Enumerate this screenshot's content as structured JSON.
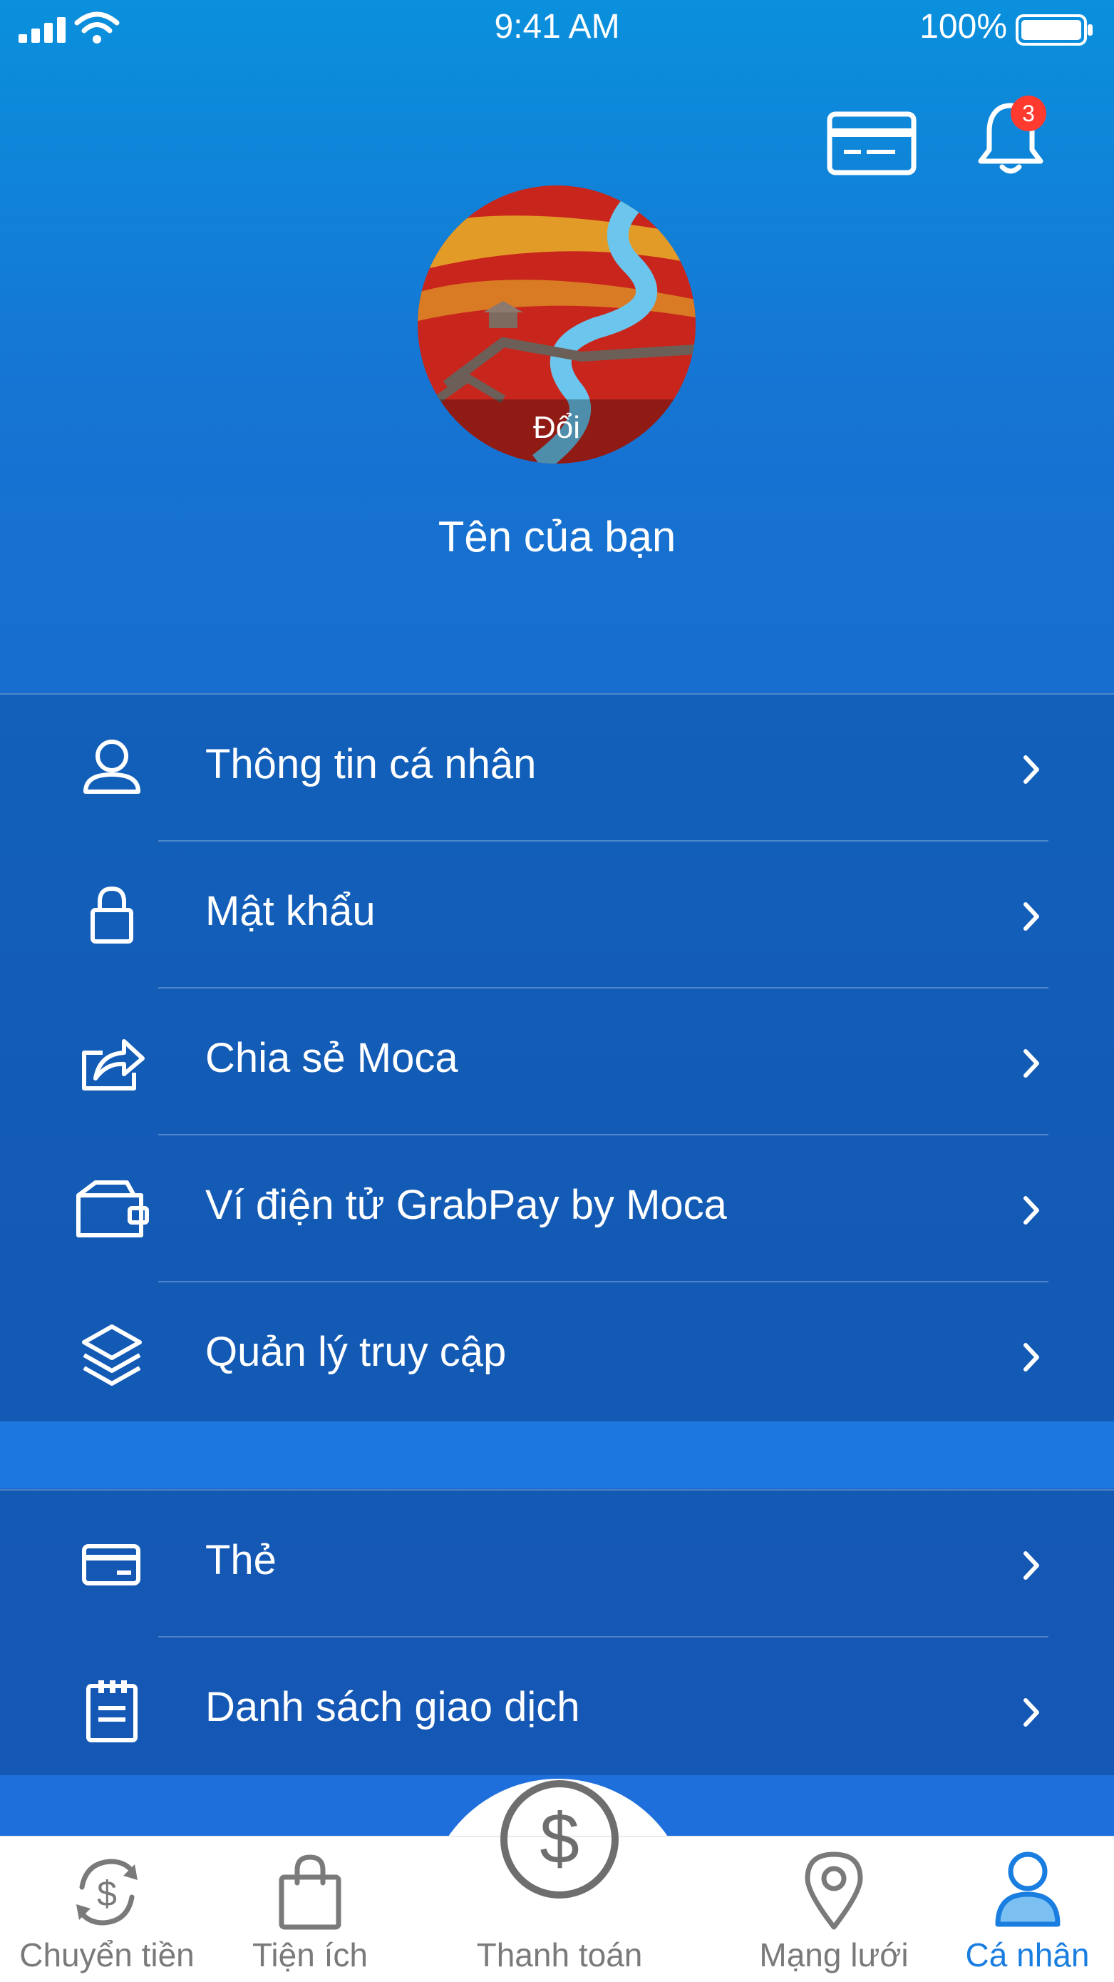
{
  "status_bar": {
    "time": "9:41 AM",
    "battery": "100%"
  },
  "header": {
    "notification_count": "3"
  },
  "profile": {
    "change_photo_label": "Đổi",
    "name": "Tên của bạn"
  },
  "menu_group_1": [
    {
      "label": "Thông tin cá nhân",
      "icon": "user-icon"
    },
    {
      "label": "Mật khẩu",
      "icon": "lock-icon"
    },
    {
      "label": "Chia sẻ Moca",
      "icon": "share-icon"
    },
    {
      "label": "Ví điện tử GrabPay by Moca",
      "icon": "wallet-icon"
    },
    {
      "label": "Quản lý truy cập",
      "icon": "layers-icon"
    }
  ],
  "menu_group_2": [
    {
      "label": "Thẻ",
      "icon": "card-icon"
    },
    {
      "label": "Danh sách giao dịch",
      "icon": "clipboard-icon"
    }
  ],
  "tabs": [
    {
      "label": "Chuyển tiền",
      "icon": "transfer-icon"
    },
    {
      "label": "Tiện ích",
      "icon": "shopping-bag-icon"
    },
    {
      "label": "Thanh toán",
      "icon": "dollar-icon"
    },
    {
      "label": "Mạng lưới",
      "icon": "location-pin-icon"
    },
    {
      "label": "Cá nhân",
      "icon": "profile-icon"
    }
  ],
  "colors": {
    "accent": "#1a7ee0",
    "badge": "#ff3b30",
    "inactive_tab": "#7a7a7a"
  }
}
